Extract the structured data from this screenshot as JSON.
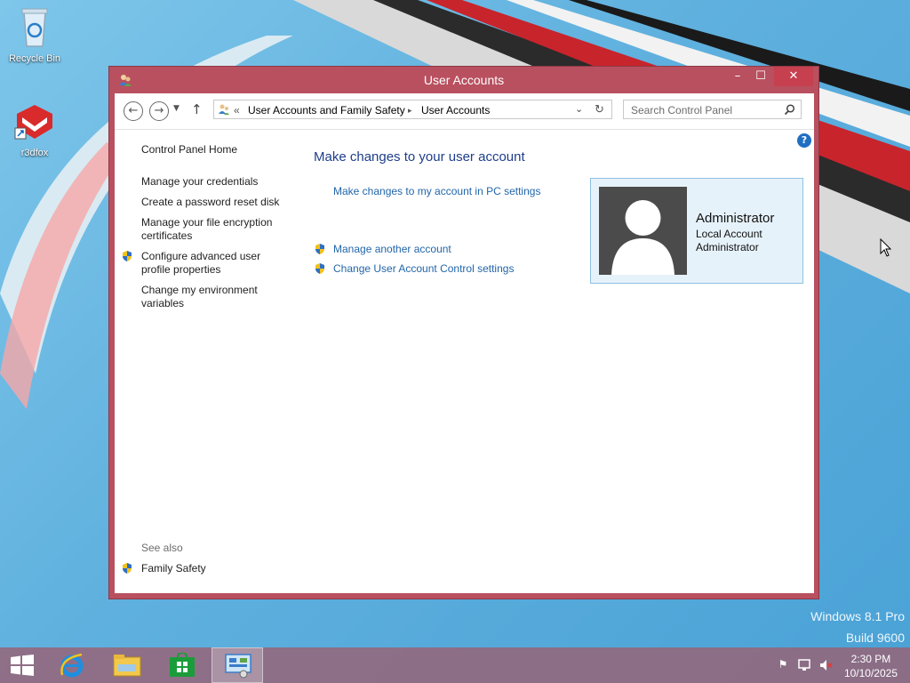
{
  "desktop": {
    "icons": [
      {
        "label": "Recycle Bin",
        "icon": "recycle-bin-icon"
      },
      {
        "label": "r3dfox",
        "icon": "r3dfox-icon"
      }
    ],
    "watermark": {
      "line1": "Windows 8.1 Pro",
      "line2": "Build 9600"
    }
  },
  "window": {
    "title": "User Accounts",
    "controls": {
      "minimize": "–",
      "maximize": "☐",
      "close": "✕"
    },
    "address": {
      "chevron": "«",
      "crumbs": [
        "User Accounts and Family Safety",
        "User Accounts"
      ],
      "separator": "▸"
    },
    "search": {
      "placeholder": "Search Control Panel"
    },
    "help": "?",
    "left_pane": {
      "home": "Control Panel Home",
      "items": [
        "Manage your credentials",
        "Create a password reset disk",
        "Manage your file encryption certificates",
        "Configure advanced user profile properties",
        "Change my environment variables"
      ],
      "see_also_label": "See also",
      "see_also": [
        "Family Safety"
      ]
    },
    "main": {
      "heading": "Make changes to your user account",
      "pc_settings_link": "Make changes to my account in PC settings",
      "links": [
        "Manage another account",
        "Change User Account Control settings"
      ],
      "account": {
        "name": "Administrator",
        "type": "Local Account",
        "role": "Administrator"
      }
    }
  },
  "taskbar": {
    "apps": [
      "start-icon",
      "internet-explorer-icon",
      "file-explorer-icon",
      "store-icon",
      "control-panel-icon"
    ],
    "clock": {
      "time": "2:30 PM",
      "date": "10/10/2025"
    }
  },
  "colors": {
    "window_frame": "#b9505f",
    "link": "#2266aa",
    "heading": "#1e3e8c",
    "card_bg": "#e6f2fa"
  }
}
